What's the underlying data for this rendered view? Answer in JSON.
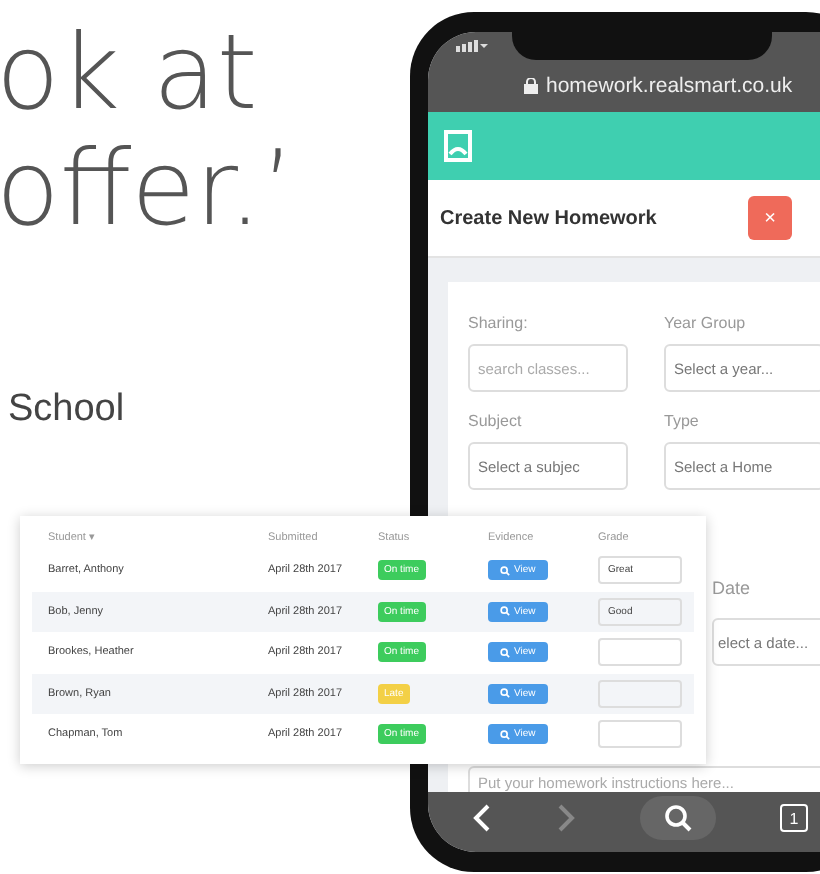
{
  "quote": {
    "lines": [
      "ok at",
      "offer.’"
    ],
    "attribution": "School"
  },
  "phone": {
    "url": "homework.realsmart.co.uk",
    "dialog": {
      "title": "Create New Homework",
      "close": "×"
    },
    "form": {
      "fields": [
        {
          "label": "Sharing:",
          "placeholder": "search classes..."
        },
        {
          "label": "Year Group",
          "value": "Select a year..."
        },
        {
          "label": "Subject",
          "value": "Select a subjec"
        },
        {
          "label": "Type",
          "value": "Select a Home"
        }
      ],
      "date_label": "Date",
      "date_value": "elect a date...",
      "instructions_placeholder": "Put your homework instructions here..."
    },
    "toolbar": {
      "tab_count": "1"
    }
  },
  "table": {
    "columns": [
      "Student ▾",
      "Submitted",
      "Status",
      "Evidence",
      "Grade"
    ],
    "rows": [
      {
        "student": "Barret, Anthony",
        "submitted": "April 28th 2017",
        "status": "On time",
        "kind": "on_time",
        "evidence": "View",
        "grade": "Great"
      },
      {
        "student": "Bob, Jenny",
        "submitted": "April 28th 2017",
        "status": "On time",
        "kind": "on_time",
        "evidence": "View",
        "grade": "Good"
      },
      {
        "student": "Brookes, Heather",
        "submitted": "April 28th 2017",
        "status": "On time",
        "kind": "on_time",
        "evidence": "View"
      },
      {
        "student": "Brown, Ryan",
        "submitted": "April 28th 2017",
        "status": "Late",
        "kind": "late",
        "evidence": "View"
      },
      {
        "student": "Chapman, Tom",
        "submitted": "April 28th 2017",
        "status": "On time",
        "kind": "on_time",
        "evidence": "View"
      }
    ]
  }
}
